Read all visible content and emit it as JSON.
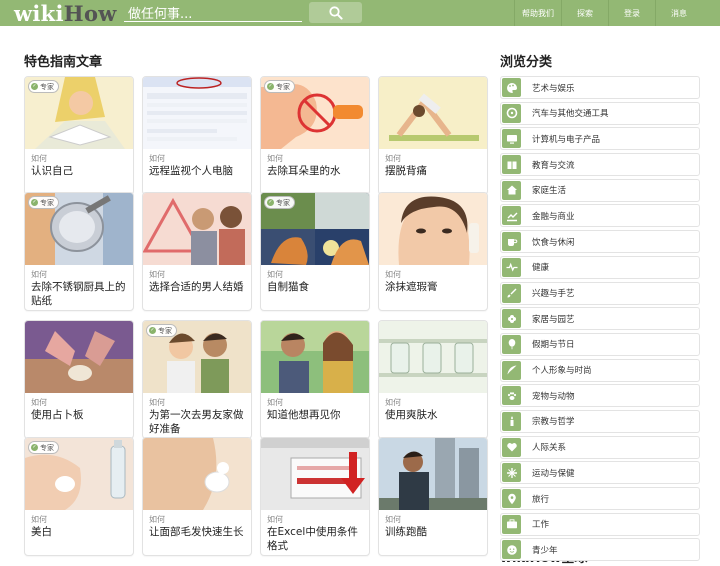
{
  "header": {
    "logo_wiki": "wiki",
    "logo_how": "How",
    "search_placeholder": "做任何事...",
    "nav": [
      "帮助我们",
      "探索",
      "登录",
      "消息"
    ]
  },
  "main": {
    "heading": "特色指南文章",
    "badge_label": "专家",
    "articles": [
      {
        "prefix": "如何",
        "title": "认识自己",
        "expert": true,
        "icon": "reading-woman"
      },
      {
        "prefix": "如何",
        "title": "远程监视个人电脑",
        "expert": false,
        "icon": "screenshot"
      },
      {
        "prefix": "如何",
        "title": "去除耳朵里的水",
        "expert": true,
        "icon": "ear-no"
      },
      {
        "prefix": "如何",
        "title": "摆脱背痛",
        "expert": false,
        "icon": "yoga"
      },
      {
        "prefix": "如何",
        "title": "去除不锈钢厨具上的贴纸",
        "expert": true,
        "icon": "pan"
      },
      {
        "prefix": "如何",
        "title": "选择合适的男人结婚",
        "expert": false,
        "icon": "couple-warning"
      },
      {
        "prefix": "如何",
        "title": "自制猫食",
        "expert": true,
        "icon": "cats"
      },
      {
        "prefix": "如何",
        "title": "涂抹遮瑕膏",
        "expert": false,
        "icon": "concealer"
      },
      {
        "prefix": "如何",
        "title": "使用占卜板",
        "expert": false,
        "icon": "ouija"
      },
      {
        "prefix": "如何",
        "title": "为第一次去男友家做好准备",
        "expert": true,
        "icon": "couple"
      },
      {
        "prefix": "如何",
        "title": "知道他想再见你",
        "expert": false,
        "icon": "date"
      },
      {
        "prefix": "如何",
        "title": "使用爽肤水",
        "expert": false,
        "icon": "bottles"
      },
      {
        "prefix": "如何",
        "title": "美白",
        "expert": true,
        "icon": "lotion"
      },
      {
        "prefix": "如何",
        "title": "让面部毛发快速生长",
        "expert": false,
        "icon": "beard"
      },
      {
        "prefix": "如何",
        "title": "在Excel中使用条件格式",
        "expert": false,
        "icon": "excel"
      },
      {
        "prefix": "如何",
        "title": "训练跑酷",
        "expert": false,
        "icon": "parkour"
      }
    ]
  },
  "sidebar": {
    "heading": "浏览分类",
    "categories": [
      {
        "label": "艺术与娱乐",
        "icon": "palette-icon"
      },
      {
        "label": "汽车与其他交通工具",
        "icon": "wheel-icon"
      },
      {
        "label": "计算机与电子产品",
        "icon": "monitor-icon"
      },
      {
        "label": "教育与交流",
        "icon": "book-icon"
      },
      {
        "label": "家庭生活",
        "icon": "house-icon"
      },
      {
        "label": "金融与商业",
        "icon": "chart-icon"
      },
      {
        "label": "饮食与休闲",
        "icon": "cup-icon"
      },
      {
        "label": "健康",
        "icon": "heartbeat-icon"
      },
      {
        "label": "兴趣与手艺",
        "icon": "brush-icon"
      },
      {
        "label": "家居与园艺",
        "icon": "flower-icon"
      },
      {
        "label": "假期与节日",
        "icon": "balloon-icon"
      },
      {
        "label": "个人形象与时尚",
        "icon": "feather-icon"
      },
      {
        "label": "宠物与动物",
        "icon": "paw-icon"
      },
      {
        "label": "宗教与哲学",
        "icon": "candle-icon"
      },
      {
        "label": "人际关系",
        "icon": "heart-icon"
      },
      {
        "label": "运动与保健",
        "icon": "sport-icon"
      },
      {
        "label": "旅行",
        "icon": "pin-icon"
      },
      {
        "label": "工作",
        "icon": "briefcase-icon"
      },
      {
        "label": "青少年",
        "icon": "face-icon"
      }
    ],
    "global_heading": "wikiHow全球"
  },
  "colors": {
    "brand_green": "#93b874",
    "badge_green": "#8ab36b"
  }
}
